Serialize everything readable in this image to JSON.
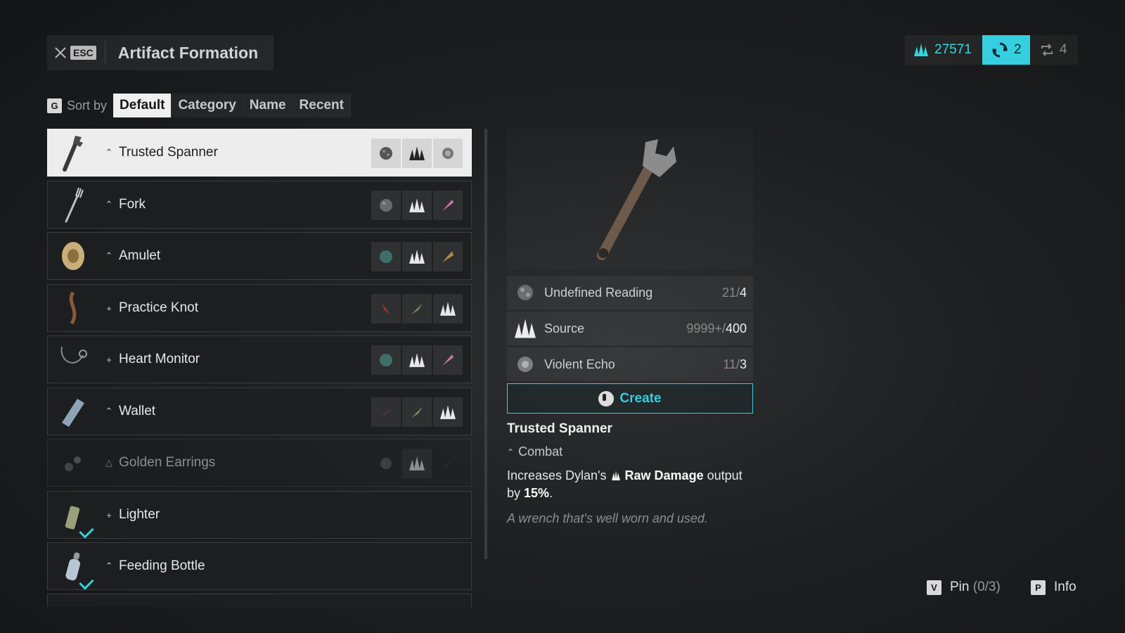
{
  "header": {
    "close_key": "ESC",
    "title": "Artifact Formation"
  },
  "currencies": {
    "source": "27571",
    "cycle": "2",
    "swap": "4"
  },
  "sort": {
    "key": "G",
    "label": "Sort by",
    "tabs": [
      "Default",
      "Category",
      "Name",
      "Recent"
    ],
    "active": "Default"
  },
  "items": [
    {
      "name": "Trusted Spanner",
      "tier": "⌃",
      "selected": true,
      "icon": "wrench-icon",
      "mats": [
        "reading",
        "source",
        "echo"
      ]
    },
    {
      "name": "Fork",
      "tier": "⌃",
      "icon": "fork-icon",
      "mats": [
        "reading",
        "source",
        "pink-shard"
      ]
    },
    {
      "name": "Amulet",
      "tier": "⌃",
      "icon": "amulet-icon",
      "mats": [
        "teal-stone",
        "source",
        "gold-shard"
      ]
    },
    {
      "name": "Practice Knot",
      "tier": "+",
      "icon": "knot-icon",
      "mats": [
        "red-shard",
        "green-shard",
        "source"
      ]
    },
    {
      "name": "Heart Monitor",
      "tier": "+",
      "icon": "stethoscope-icon",
      "mats": [
        "teal-stone",
        "source",
        "pink-shard"
      ]
    },
    {
      "name": "Wallet",
      "tier": "⌃",
      "icon": "wallet-icon",
      "mats": [
        "red-shard",
        "green-shard",
        "source"
      ]
    },
    {
      "name": "Golden Earrings",
      "tier": "△",
      "dim": true,
      "icon": "earrings-icon",
      "mats": [
        "dark-stone",
        "source",
        "dark-shard"
      ]
    },
    {
      "name": "Lighter",
      "tier": "+",
      "icon": "lighter-icon",
      "owned": true
    },
    {
      "name": "Feeding Bottle",
      "tier": "⌃",
      "icon": "bottle-icon",
      "owned": true
    }
  ],
  "requirements": [
    {
      "name": "Undefined Reading",
      "have": "21",
      "need": "4",
      "icon": "reading-icon"
    },
    {
      "name": "Source",
      "have": "9999+",
      "need": "400",
      "icon": "source-icon"
    },
    {
      "name": "Violent Echo",
      "have": "11",
      "need": "3",
      "icon": "echo-icon"
    }
  ],
  "create_label": "Create",
  "detail": {
    "name": "Trusted Spanner",
    "category": "Combat",
    "desc_pre": "Increases Dylan's",
    "desc_bold": "Raw Damage",
    "desc_mid": "output by",
    "desc_pct": "15%",
    "desc_end": ".",
    "flavor": "A wrench that's well worn and used."
  },
  "hints": {
    "pin_key": "V",
    "pin_label": "Pin",
    "pin_count": "(0/3)",
    "info_key": "P",
    "info_label": "Info"
  },
  "colors": {
    "accent": "#35cfe0",
    "selected_row": "#ededed"
  }
}
